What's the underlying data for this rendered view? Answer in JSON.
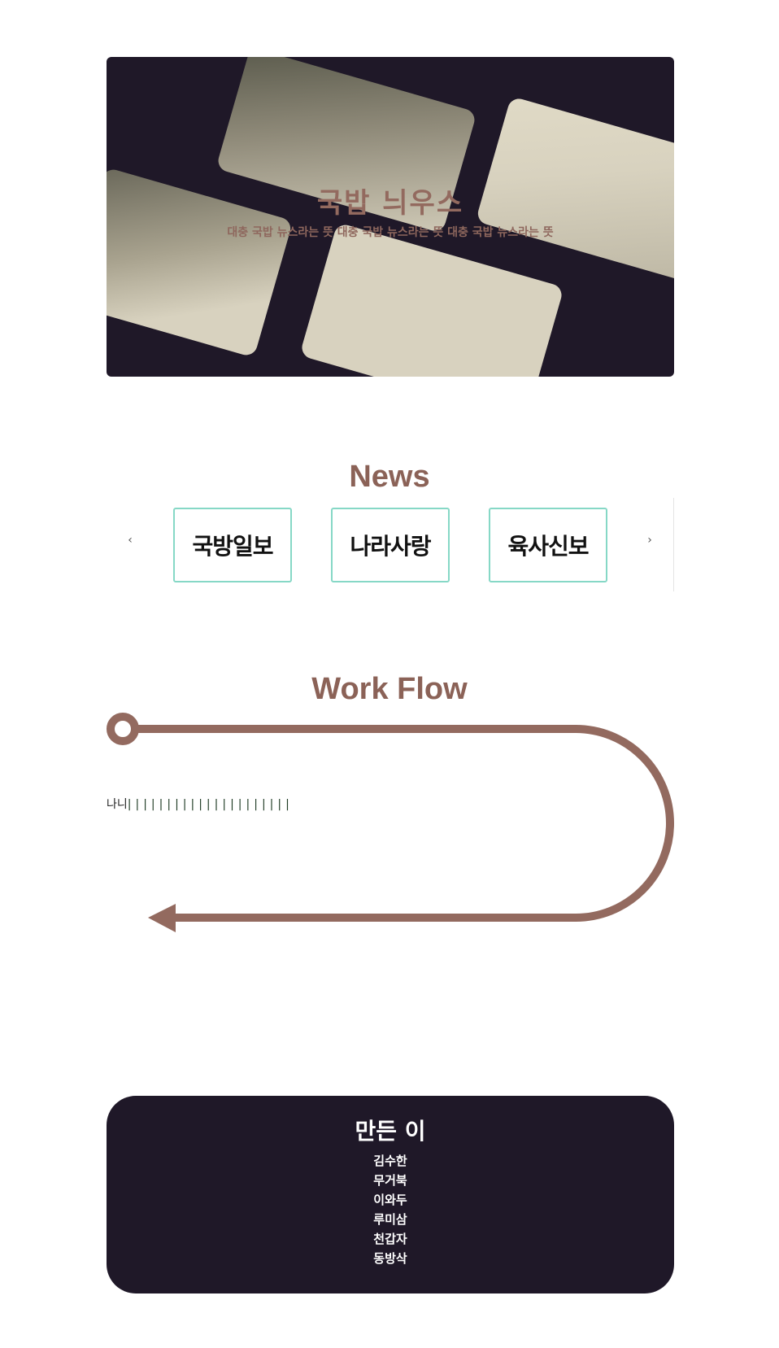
{
  "hero": {
    "title": "국밥 늬우스",
    "subtitle": "대충 국밥 뉴스라는 뜻 대충 국밥 뉴스라는 뜻 대충 국밥 뉴스라는 뜻"
  },
  "news": {
    "title": "News",
    "prev_label": "‹",
    "next_label": "›",
    "items": [
      {
        "label": "국방일보"
      },
      {
        "label": "나라사랑"
      },
      {
        "label": "육사신보"
      }
    ]
  },
  "workflow": {
    "title": "Work Flow",
    "prefix": "나니",
    "bars": "|||||||||||||||||||||",
    "accent_color": "#936a5f"
  },
  "footer": {
    "title": "만든 이",
    "members": [
      "김수한",
      "무거북",
      "이와두",
      "루미삼",
      "천갑자",
      "동방삭"
    ]
  },
  "colors": {
    "dark_bg": "#1f1828",
    "card_beige": "#d8d2bf",
    "title_brown": "#8b6257",
    "card_border": "#86d8c6"
  }
}
